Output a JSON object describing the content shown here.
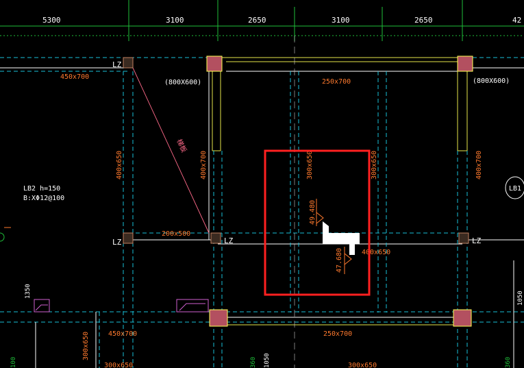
{
  "colors": {
    "background": "#000000",
    "axis_line": "#1fbf3a",
    "dim_text": "#ffffff",
    "beam_solid": "#ffffff",
    "beam_dashed": "#19c0d8",
    "beam_label": "#ff7a2e",
    "column_fill": "#b35060",
    "column_outline": "#ffff55",
    "yellow_line": "#e6e64a",
    "selection_box": "#ff2020",
    "magenta": "#d060d0",
    "cursor": "#ffffff"
  },
  "dimensions": {
    "d1": "5300",
    "d2": "3100",
    "d3": "2650",
    "d4": "3100",
    "d5": "2650",
    "d6": "42"
  },
  "beam_labels": {
    "top_left": "450x700",
    "top_mid": "250x700",
    "top_right_section": "(800X600)",
    "top_col_section": "(800X600)",
    "vert_left": "400x650",
    "vert_mid_left": "400x700",
    "vert_center_1": "300x650",
    "vert_center_2": "300x650",
    "vert_right": "400x700",
    "mid_left": "200x500",
    "mid_center": "400x650",
    "bottom_left": "450x700",
    "bottom_mid": "250x700",
    "bottom_vert_left": "300x650",
    "bottom_left_2": "300x650",
    "bottom_right": "300x650",
    "diag": "梯板"
  },
  "column_labels": {
    "lz_top_left": "LZ",
    "lz_mid_left": "LZ",
    "lz_mid_center": "LZ",
    "lz_mid_right": "LZ"
  },
  "slab_note": {
    "line1": "LB2  h=150",
    "line2": "B:XΦ12@100"
  },
  "slab_tag": "LB1",
  "measure": {
    "m1": "49.480",
    "m2": "47.680"
  },
  "side_dims": {
    "left_bottom": "1350",
    "right_bottom": "1050",
    "bottom_a": "1050",
    "left_edge": "100",
    "bottom_b": "360",
    "right_edge": "360"
  }
}
